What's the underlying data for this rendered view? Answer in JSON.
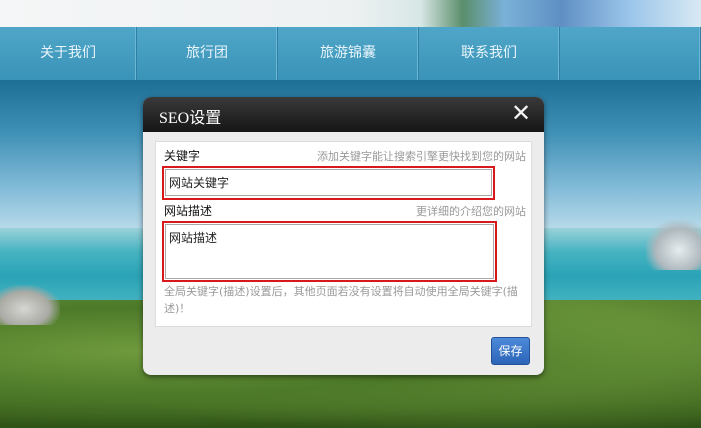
{
  "nav": {
    "items": [
      {
        "label": "关于我们"
      },
      {
        "label": "旅行团"
      },
      {
        "label": "旅游锦囊"
      },
      {
        "label": "联系我们"
      },
      {
        "label": ""
      }
    ]
  },
  "dialog": {
    "title": "SEO设置",
    "close_icon": "close-icon",
    "keyword": {
      "label": "关键字",
      "hint": "添加关键字能让搜索引擎更快找到您的网站",
      "value": "网站关键字"
    },
    "description": {
      "label": "网站描述",
      "hint": "更详细的介绍您的网站",
      "value": "网站描述"
    },
    "note": "全局关键字(描述)设置后，其他页面若没有设置将自动使用全局关键字(描述)！",
    "save_label": "保存"
  },
  "colors": {
    "nav_bg": "#3a93b8",
    "dialog_header": "#1c1c1c",
    "highlight": "#d8191c",
    "save_button": "#2c64b8"
  }
}
